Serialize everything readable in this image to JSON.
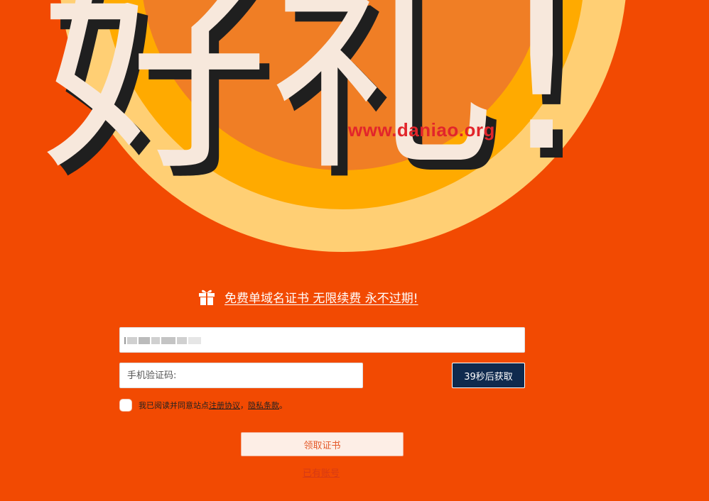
{
  "hero": {
    "headline": "好礼!",
    "watermark": "www.daniao.org",
    "colors": {
      "background": "#f24a02",
      "ring_outer": "#ffcf74",
      "ring_middle": "#ffaa00",
      "disc": "#f07e25",
      "text": "#f7e8dc",
      "shadow": "#1f1f1f"
    }
  },
  "promo": {
    "icon": "gift-icon",
    "text": "免费单域名证书 无限续费 永不过期!"
  },
  "form": {
    "phone": {
      "value": ""
    },
    "code": {
      "placeholder": "手机验证码:"
    },
    "sms_button": "39秒后获取",
    "agreement": {
      "prefix": "我已阅读并同意站点",
      "terms": "注册协议",
      "separator": "，",
      "privacy": "隐私条款",
      "suffix": "。"
    },
    "submit_label": "领取证书",
    "login_link": "已有账号"
  }
}
